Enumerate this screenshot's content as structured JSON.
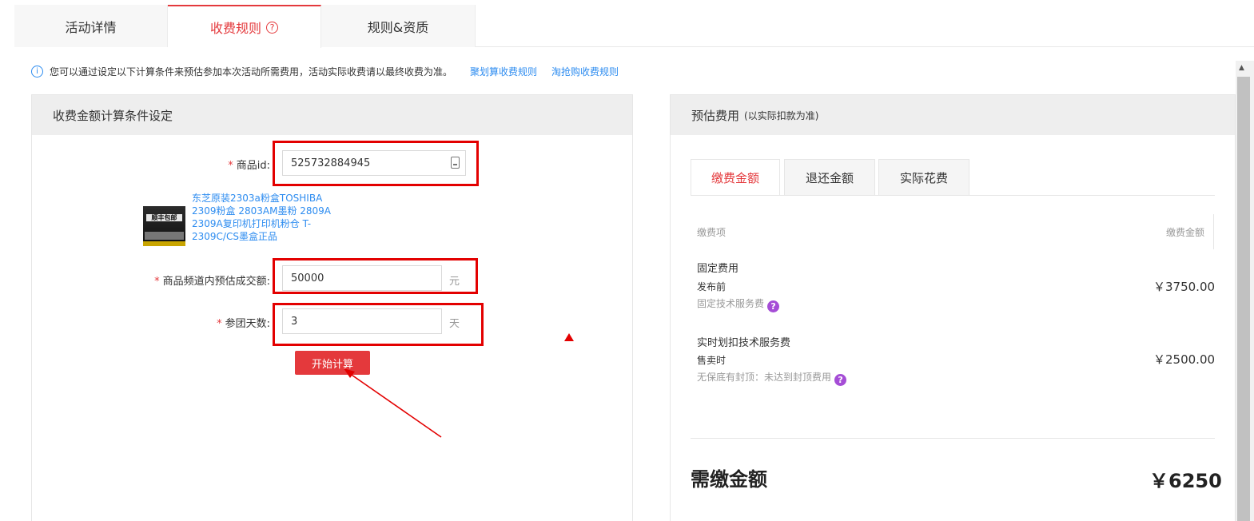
{
  "tabs": {
    "detail": "活动详情",
    "fee_rules": "收费规则",
    "fee_rules_help": "?",
    "rules_qual": "规则&资质"
  },
  "notice": {
    "icon": "i",
    "text": "您可以通过设定以下计算条件来预估参加本次活动所需费用，活动实际收费请以最终收费为准。",
    "link1": "聚划算收费规则",
    "link2": "淘抢购收费规则"
  },
  "form": {
    "header": "收费金额计算条件设定",
    "required_mark": "*",
    "product_id_label": "商品id:",
    "product_id_value": "525732884945",
    "product_title": "东芝原装2303a粉盒TOSHIBA 2309粉盒 2803AM墨粉 2809A 2309A复印机打印机粉仓 T-2309C/CS墨盒正品",
    "product_image_text": "顺丰包邮",
    "amount_label": "商品频道内预估成交额:",
    "amount_value": "50000",
    "amount_unit": "元",
    "days_label": "参团天数:",
    "days_value": "3",
    "days_unit": "天",
    "calc_button": "开始计算"
  },
  "estimate": {
    "header": "预估费用",
    "header_note": "(以实际扣款为准)",
    "tabs": [
      "缴费金额",
      "退还金额",
      "实际花费"
    ],
    "col_item": "缴费项",
    "col_amount": "缴费金额",
    "items": [
      {
        "title": "固定费用",
        "sub": "发布前",
        "note": "固定技术服务费",
        "amount": "￥3750.00"
      },
      {
        "title": "实时划扣技术服务费",
        "sub": "售卖时",
        "note": "无保底有封顶：未达到封顶费用",
        "amount": "￥2500.00"
      }
    ],
    "help_icon": "?",
    "total_label": "需缴金额",
    "total_value": "￥6250"
  },
  "scrollbar": {
    "up_arrow": "▲"
  },
  "colors": {
    "accent": "#e4393c",
    "link": "#2d8cf0",
    "annotation": "#e30000",
    "help": "#a54dd6"
  }
}
